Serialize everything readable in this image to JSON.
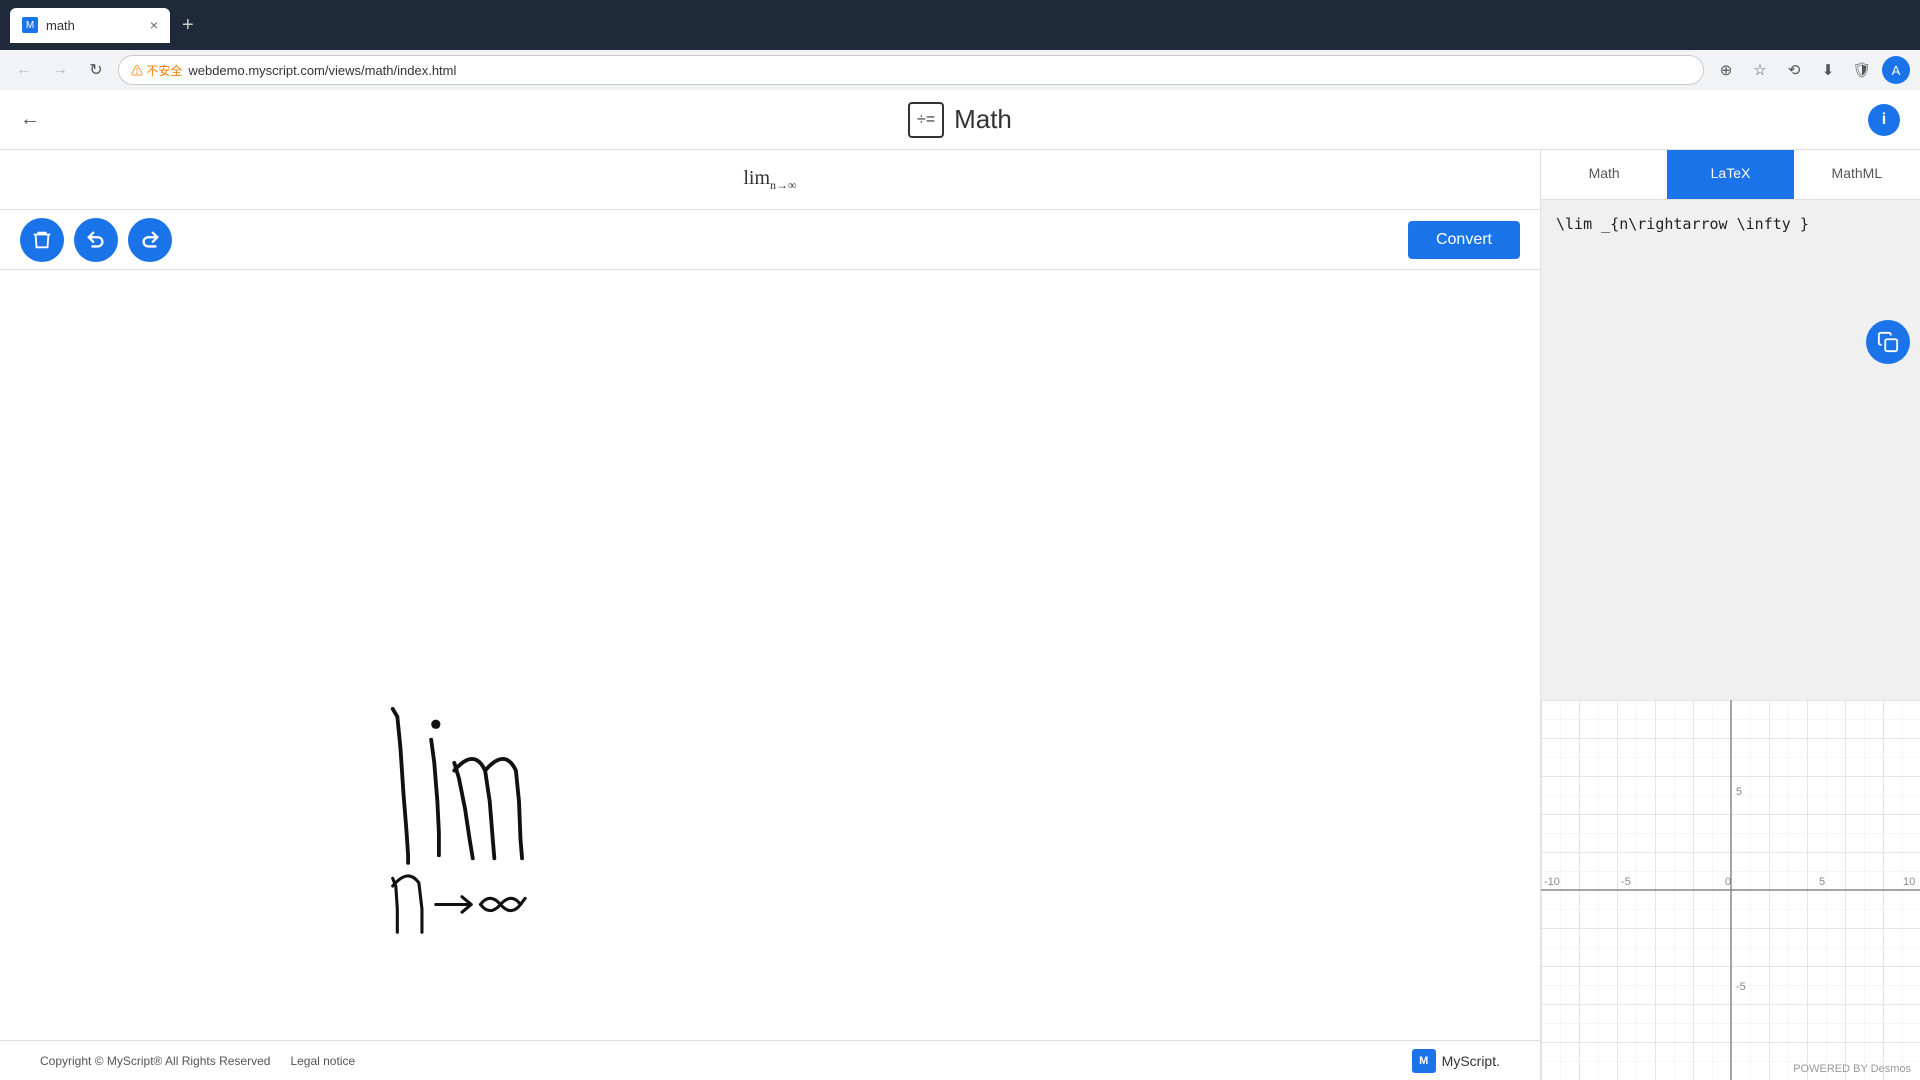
{
  "browser": {
    "tab_title": "math",
    "tab_favicon": "M",
    "new_tab_label": "+",
    "close_tab_label": "×",
    "nav": {
      "back": "←",
      "forward": "→",
      "refresh": "↻",
      "warning_label": "⚠ 不安全",
      "url": "webdemo.myscript.com/views/math/index.html",
      "extensions": [
        "☆",
        "⟲",
        "⬇",
        "🛡"
      ],
      "profile": "A"
    }
  },
  "header": {
    "back_label": "←",
    "title": "Math",
    "icon_label": "÷=",
    "info_label": "i"
  },
  "recognition": {
    "formula_display": "lim",
    "subscript": "n→∞"
  },
  "toolbar": {
    "delete_label": "🗑",
    "undo_label": "↩",
    "redo_label": "↪",
    "convert_label": "Convert"
  },
  "panel": {
    "tabs": [
      {
        "id": "math",
        "label": "Math",
        "active": false
      },
      {
        "id": "latex",
        "label": "LaTeX",
        "active": true
      },
      {
        "id": "mathml",
        "label": "MathML",
        "active": false
      }
    ],
    "latex_content": "\\lim _{n\\rightarrow \\infty }",
    "copy_label": "⧉"
  },
  "graph": {
    "x_labels": [
      "-10",
      "-5",
      "0",
      "5",
      "10"
    ],
    "y_labels": [
      "5",
      "-5"
    ],
    "powered_by": "POWERED BY Desmos"
  },
  "footer": {
    "copyright": "Copyright © MyScript® All Rights Reserved",
    "legal_notice": "Legal notice",
    "logo_label": "M",
    "brand": "MyScript."
  }
}
